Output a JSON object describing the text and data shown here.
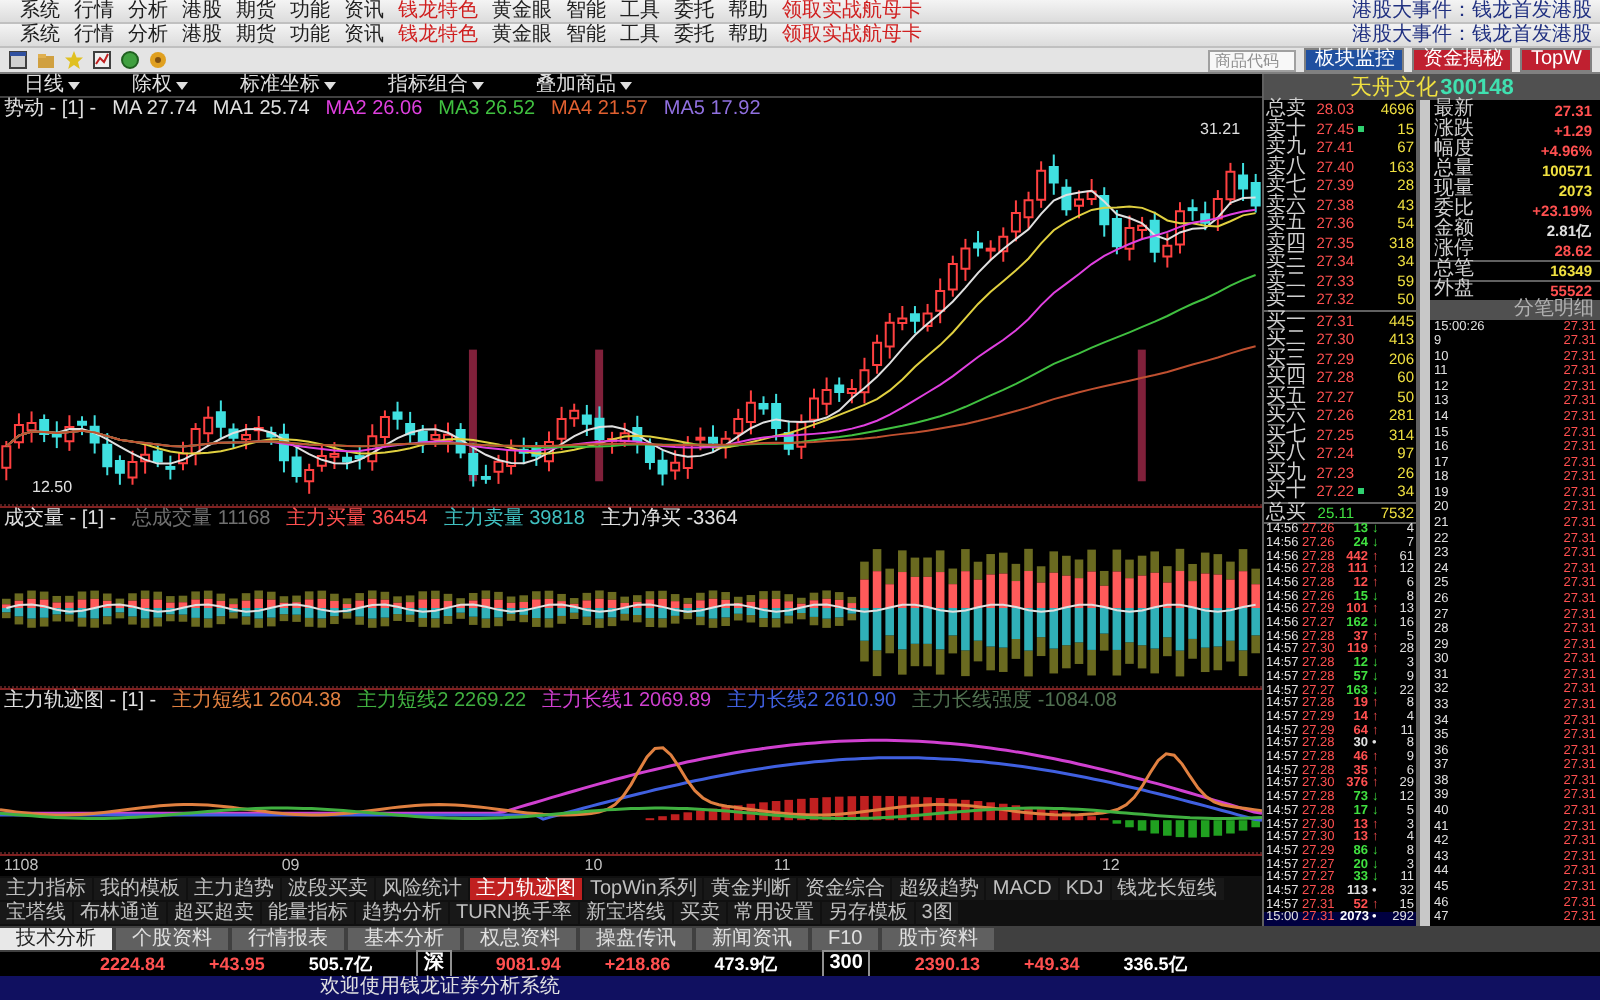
{
  "menu_bars": [
    {
      "items": [
        {
          "label": "系统",
          "highlight": false
        },
        {
          "label": "行情",
          "highlight": false
        },
        {
          "label": "分析",
          "highlight": false
        },
        {
          "label": "港股",
          "highlight": false
        },
        {
          "label": "期货",
          "highlight": false
        },
        {
          "label": "功能",
          "highlight": false
        },
        {
          "label": "资讯",
          "highlight": false
        },
        {
          "label": "钱龙特色",
          "highlight": true
        },
        {
          "label": "黄金眼",
          "highlight": false
        },
        {
          "label": "智能",
          "highlight": false
        },
        {
          "label": "工具",
          "highlight": false
        },
        {
          "label": "委托",
          "highlight": false
        },
        {
          "label": "帮助",
          "highlight": false
        },
        {
          "label": "领取实战航母卡",
          "highlight": true
        }
      ],
      "notice": "港股大事件：钱龙首发港股"
    },
    {
      "items": [
        {
          "label": "系统",
          "highlight": false
        },
        {
          "label": "行情",
          "highlight": false
        },
        {
          "label": "分析",
          "highlight": false
        },
        {
          "label": "港股",
          "highlight": false
        },
        {
          "label": "期货",
          "highlight": false
        },
        {
          "label": "功能",
          "highlight": false
        },
        {
          "label": "资讯",
          "highlight": false
        },
        {
          "label": "钱龙特色",
          "highlight": true
        },
        {
          "label": "黄金眼",
          "highlight": false
        },
        {
          "label": "智能",
          "highlight": false
        },
        {
          "label": "工具",
          "highlight": false
        },
        {
          "label": "委托",
          "highlight": false
        },
        {
          "label": "帮助",
          "highlight": false
        },
        {
          "label": "领取实战航母卡",
          "highlight": true
        }
      ],
      "notice": "港股大事件：钱龙首发港股"
    }
  ],
  "toolbar": {
    "search": {
      "placeholder": "商品代码"
    },
    "buttons": [
      {
        "label": "板块监控",
        "color": "#2050a0"
      },
      {
        "label": "资金揭秘",
        "color": "#c02030"
      },
      {
        "label": "TopW",
        "color": "#c02030"
      }
    ]
  },
  "chart_toolbar": {
    "dropdowns": [
      "日线",
      "除权",
      "标准坐标",
      "指标组合",
      "叠加商品"
    ]
  },
  "ma_row": {
    "title": "势动 - [1] -",
    "values": [
      {
        "label": "MA",
        "value": "27.74",
        "color": "#e0e0e0"
      },
      {
        "label": "MA1",
        "value": "25.74",
        "color": "#e0e0e0"
      },
      {
        "label": "MA2",
        "value": "26.06",
        "color": "#e040e0"
      },
      {
        "label": "MA3",
        "value": "26.52",
        "color": "#40c040"
      },
      {
        "label": "MA4",
        "value": "21.57",
        "color": "#e06030"
      },
      {
        "label": "MA5",
        "value": "17.92",
        "color": "#9070e0"
      }
    ]
  },
  "main_chart": {
    "high_label": "31.21",
    "low_label": "12.50"
  },
  "volume_panel": {
    "title": "成交量 - [1] -",
    "values": [
      {
        "label": "总成交量",
        "value": "11168",
        "color": "#707070"
      },
      {
        "label": "主力买量",
        "value": "36454",
        "color": "#ff5050"
      },
      {
        "label": "主力卖量",
        "value": "39818",
        "color": "#40c0c0"
      },
      {
        "label": "主力净买",
        "value": "-3364",
        "color": "#e0e0e0"
      }
    ]
  },
  "trajectory_panel": {
    "title": "主力轨迹图 - [1] -",
    "values": [
      {
        "label": "主力短线1",
        "value": "2604.38",
        "color": "#e08040"
      },
      {
        "label": "主力短线2",
        "value": "2269.22",
        "color": "#40b040"
      },
      {
        "label": "主力长线1",
        "value": "2069.89",
        "color": "#d040d0"
      },
      {
        "label": "主力长线2",
        "value": "2610.90",
        "color": "#4060e0"
      },
      {
        "label": "主力长线强度",
        "value": "-1084.08",
        "color": "#507050"
      }
    ]
  },
  "x_axis": [
    "1108",
    "09",
    "10",
    "11",
    "12"
  ],
  "indicator_tabs": [
    {
      "label": "主力指标",
      "selected": false
    },
    {
      "label": "我的模板",
      "selected": false
    },
    {
      "label": "主力趋势",
      "selected": false
    },
    {
      "label": "波段买卖",
      "selected": false
    },
    {
      "label": "风险统计",
      "selected": false
    },
    {
      "label": "主力轨迹图",
      "selected": true
    },
    {
      "label": "TopWin系列",
      "selected": false
    },
    {
      "label": "黄金判断",
      "selected": false
    },
    {
      "label": "资金综合",
      "selected": false
    },
    {
      "label": "超级趋势",
      "selected": false
    },
    {
      "label": "MACD",
      "selected": false
    },
    {
      "label": "KDJ",
      "selected": false
    },
    {
      "label": "钱龙长短线",
      "selected": false
    },
    {
      "label": "宝塔线",
      "selected": false
    },
    {
      "label": "布林通道",
      "selected": false
    },
    {
      "label": "超买超卖",
      "selected": false
    },
    {
      "label": "能量指标",
      "selected": false
    },
    {
      "label": "趋势分析",
      "selected": false
    },
    {
      "label": "TURN换手率",
      "selected": false
    },
    {
      "label": "新宝塔线",
      "selected": false
    },
    {
      "label": "买卖",
      "selected": false
    },
    {
      "label": "常用设置",
      "selected": false
    },
    {
      "label": "另存模板",
      "selected": false
    },
    {
      "label": "3图",
      "selected": false
    }
  ],
  "bottom_tabs": [
    {
      "label": "技术分析",
      "selected": true
    },
    {
      "label": "个股资料",
      "selected": false
    },
    {
      "label": "行情报表",
      "selected": false
    },
    {
      "label": "基本分析",
      "selected": false
    },
    {
      "label": "权息资料",
      "selected": false
    },
    {
      "label": "操盘传讯",
      "selected": false
    },
    {
      "label": "新闻资讯",
      "selected": false
    },
    {
      "label": "F10",
      "selected": false
    },
    {
      "label": "股市资料",
      "selected": false
    }
  ],
  "status_bar": [
    {
      "text": "2224.84",
      "color": "#ff5050",
      "boxed": false
    },
    {
      "text": "+43.95",
      "color": "#ff5050",
      "boxed": false
    },
    {
      "text": "505.7亿",
      "color": "#ffffff",
      "boxed": false
    },
    {
      "text": "深",
      "boxed": true
    },
    {
      "text": "9081.94",
      "color": "#ff5050",
      "boxed": false
    },
    {
      "text": "+218.86",
      "color": "#ff5050",
      "boxed": false
    },
    {
      "text": "473.9亿",
      "color": "#ffffff",
      "boxed": false
    },
    {
      "text": "300",
      "boxed": true
    },
    {
      "text": "2390.13",
      "color": "#ff5050",
      "boxed": false
    },
    {
      "text": "+49.34",
      "color": "#ff5050",
      "boxed": false
    },
    {
      "text": "336.5亿",
      "color": "#ffffff",
      "boxed": false
    }
  ],
  "ticker": "欢迎使用钱龙证券分析系统",
  "quote": {
    "name": "天舟文化",
    "code": "300148",
    "total_sell": {
      "label": "总卖",
      "price": "28.03",
      "volume": "4696"
    },
    "asks": [
      {
        "label": "卖十",
        "price": "27.45",
        "volume": "15",
        "flag": true
      },
      {
        "label": "卖九",
        "price": "27.41",
        "volume": "67",
        "flag": false
      },
      {
        "label": "卖八",
        "price": "27.40",
        "volume": "163",
        "flag": false
      },
      {
        "label": "卖七",
        "price": "27.39",
        "volume": "28",
        "flag": false
      },
      {
        "label": "卖六",
        "price": "27.38",
        "volume": "43",
        "flag": false
      },
      {
        "label": "卖五",
        "price": "27.36",
        "volume": "54",
        "flag": false
      },
      {
        "label": "卖四",
        "price": "27.35",
        "volume": "318",
        "flag": false
      },
      {
        "label": "卖三",
        "price": "27.34",
        "volume": "34",
        "flag": false
      },
      {
        "label": "卖二",
        "price": "27.33",
        "volume": "59",
        "flag": false
      },
      {
        "label": "卖一",
        "price": "27.32",
        "volume": "50",
        "flag": false
      }
    ],
    "bids": [
      {
        "label": "买一",
        "price": "27.31",
        "volume": "445",
        "flag": false
      },
      {
        "label": "买二",
        "price": "27.30",
        "volume": "413",
        "flag": false
      },
      {
        "label": "买三",
        "price": "27.29",
        "volume": "206",
        "flag": false
      },
      {
        "label": "买四",
        "price": "27.28",
        "volume": "60",
        "flag": false
      },
      {
        "label": "买五",
        "price": "27.27",
        "volume": "50",
        "flag": false
      },
      {
        "label": "买六",
        "price": "27.26",
        "volume": "281",
        "flag": false
      },
      {
        "label": "买七",
        "price": "27.25",
        "volume": "314",
        "flag": false
      },
      {
        "label": "买八",
        "price": "27.24",
        "volume": "97",
        "flag": false
      },
      {
        "label": "买九",
        "price": "27.23",
        "volume": "26",
        "flag": false
      },
      {
        "label": "买十",
        "price": "27.22",
        "volume": "34",
        "flag": true
      }
    ],
    "total_buy": {
      "label": "总买",
      "price": "25.11",
      "volume": "7532"
    },
    "stats": [
      {
        "label": "最新",
        "value": "27.31",
        "color": "#ff5050"
      },
      {
        "label": "涨跌",
        "value": "+1.29",
        "color": "#ff5050"
      },
      {
        "label": "幅度",
        "value": "+4.96%",
        "color": "#ff5050"
      },
      {
        "label": "总量",
        "value": "100571",
        "color": "#f0e040"
      },
      {
        "label": "现量",
        "value": "2073",
        "color": "#f0e040"
      },
      {
        "label": "委比",
        "value": "+23.19%",
        "color": "#ff5050"
      },
      {
        "label": "金额",
        "value": "2.81亿",
        "color": "#e0e0e0"
      },
      {
        "label": "涨停",
        "value": "28.62",
        "color": "#ff5050"
      }
    ],
    "summary": [
      {
        "label": "总笔",
        "value": "16349",
        "color": "#f0e040"
      },
      {
        "label": "外盘",
        "value": "55522",
        "color": "#ff5050"
      }
    ],
    "trades": [
      {
        "time": "14:56",
        "price": "27.26",
        "volume": "13",
        "arrow": "↓",
        "color": "#40e040",
        "count": "4"
      },
      {
        "time": "14:56",
        "price": "27.26",
        "volume": "24",
        "arrow": "↓",
        "color": "#40e040",
        "count": "7"
      },
      {
        "time": "14:56",
        "price": "27.28",
        "volume": "442",
        "arrow": "↑",
        "color": "#ff5050",
        "count": "61"
      },
      {
        "time": "14:56",
        "price": "27.28",
        "volume": "111",
        "arrow": "↑",
        "color": "#ff5050",
        "count": "12"
      },
      {
        "time": "14:56",
        "price": "27.28",
        "volume": "12",
        "arrow": "↑",
        "color": "#ff5050",
        "count": "6"
      },
      {
        "time": "14:56",
        "price": "27.26",
        "volume": "15",
        "arrow": "↓",
        "color": "#40e040",
        "count": "8"
      },
      {
        "time": "14:56",
        "price": "27.29",
        "volume": "101",
        "arrow": "↑",
        "color": "#ff5050",
        "count": "13"
      },
      {
        "time": "14:56",
        "price": "27.27",
        "volume": "162",
        "arrow": "↓",
        "color": "#40e040",
        "count": "16"
      },
      {
        "time": "14:56",
        "price": "27.28",
        "volume": "37",
        "arrow": "↑",
        "color": "#ff5050",
        "count": "5"
      },
      {
        "time": "14:57",
        "price": "27.30",
        "volume": "119",
        "arrow": "↑",
        "color": "#ff5050",
        "count": "28"
      },
      {
        "time": "14:57",
        "price": "27.28",
        "volume": "12",
        "arrow": "↓",
        "color": "#40e040",
        "count": "3"
      },
      {
        "time": "14:57",
        "price": "27.28",
        "volume": "57",
        "arrow": "↓",
        "color": "#40e040",
        "count": "9"
      },
      {
        "time": "14:57",
        "price": "27.27",
        "volume": "163",
        "arrow": "↓",
        "color": "#40e040",
        "count": "22"
      },
      {
        "time": "14:57",
        "price": "27.28",
        "volume": "19",
        "arrow": "↑",
        "color": "#ff5050",
        "count": "8"
      },
      {
        "time": "14:57",
        "price": "27.29",
        "volume": "14",
        "arrow": "↑",
        "color": "#ff5050",
        "count": "4"
      },
      {
        "time": "14:57",
        "price": "27.29",
        "volume": "64",
        "arrow": "↑",
        "color": "#ff5050",
        "count": "11"
      },
      {
        "time": "14:57",
        "price": "27.28",
        "volume": "30",
        "arrow": "•",
        "color": "#e0e0e0",
        "count": "8"
      },
      {
        "time": "14:57",
        "price": "27.28",
        "volume": "46",
        "arrow": "↑",
        "color": "#ff5050",
        "count": "9"
      },
      {
        "time": "14:57",
        "price": "27.28",
        "volume": "35",
        "arrow": "↑",
        "color": "#ff5050",
        "count": "6"
      },
      {
        "time": "14:57",
        "price": "27.30",
        "volume": "376",
        "arrow": "↑",
        "color": "#ff5050",
        "count": "29"
      },
      {
        "time": "14:57",
        "price": "27.28",
        "volume": "73",
        "arrow": "↓",
        "color": "#40e040",
        "count": "12"
      },
      {
        "time": "14:57",
        "price": "27.28",
        "volume": "17",
        "arrow": "↓",
        "color": "#40e040",
        "count": "5"
      },
      {
        "time": "14:57",
        "price": "27.30",
        "volume": "13",
        "arrow": "↑",
        "color": "#ff5050",
        "count": "3"
      },
      {
        "time": "14:57",
        "price": "27.30",
        "volume": "13",
        "arrow": "↑",
        "color": "#ff5050",
        "count": "4"
      },
      {
        "time": "14:57",
        "price": "27.29",
        "volume": "86",
        "arrow": "↓",
        "color": "#40e040",
        "count": "8"
      },
      {
        "time": "14:57",
        "price": "27.27",
        "volume": "20",
        "arrow": "↓",
        "color": "#40e040",
        "count": "3"
      },
      {
        "time": "14:57",
        "price": "27.27",
        "volume": "33",
        "arrow": "↓",
        "color": "#40e040",
        "count": "11"
      },
      {
        "time": "14:57",
        "price": "27.28",
        "volume": "113",
        "arrow": "•",
        "color": "#e0e0e0",
        "count": "32"
      },
      {
        "time": "14:57",
        "price": "27.31",
        "volume": "52",
        "arrow": "↑",
        "color": "#ff5050",
        "count": "15"
      },
      {
        "time": "15:00",
        "price": "27.31",
        "volume": "2073",
        "arrow": "•",
        "color": "#ffffff",
        "count": "292"
      }
    ],
    "ticks_header": "分笔明细",
    "ticks": [
      {
        "time": "15:00:26",
        "price": "27.31"
      },
      {
        "time": "9",
        "price": "27.31"
      },
      {
        "time": "10",
        "price": "27.31"
      },
      {
        "time": "11",
        "price": "27.31"
      },
      {
        "time": "12",
        "price": "27.31"
      },
      {
        "time": "13",
        "price": "27.31"
      },
      {
        "time": "14",
        "price": "27.31"
      },
      {
        "time": "15",
        "price": "27.31"
      },
      {
        "time": "16",
        "price": "27.31"
      },
      {
        "time": "17",
        "price": "27.31"
      },
      {
        "time": "18",
        "price": "27.31"
      },
      {
        "time": "19",
        "price": "27.31"
      },
      {
        "time": "20",
        "price": "27.31"
      },
      {
        "time": "21",
        "price": "27.31"
      },
      {
        "time": "22",
        "price": "27.31"
      },
      {
        "time": "23",
        "price": "27.31"
      },
      {
        "time": "24",
        "price": "27.31"
      },
      {
        "time": "25",
        "price": "27.31"
      },
      {
        "time": "26",
        "price": "27.31"
      },
      {
        "time": "27",
        "price": "27.31"
      },
      {
        "time": "28",
        "price": "27.31"
      },
      {
        "time": "29",
        "price": "27.31"
      },
      {
        "time": "30",
        "price": "27.31"
      },
      {
        "time": "31",
        "price": "27.31"
      },
      {
        "time": "32",
        "price": "27.31"
      },
      {
        "time": "33",
        "price": "27.31"
      },
      {
        "time": "34",
        "price": "27.31"
      },
      {
        "time": "35",
        "price": "27.31"
      },
      {
        "time": "36",
        "price": "27.31"
      },
      {
        "time": "37",
        "price": "27.31"
      },
      {
        "time": "38",
        "price": "27.31"
      },
      {
        "time": "39",
        "price": "27.31"
      },
      {
        "time": "40",
        "price": "27.31"
      },
      {
        "time": "41",
        "price": "27.31"
      },
      {
        "time": "42",
        "price": "27.31"
      },
      {
        "time": "43",
        "price": "27.31"
      },
      {
        "time": "44",
        "price": "27.31"
      },
      {
        "time": "45",
        "price": "27.31"
      },
      {
        "time": "46",
        "price": "27.31"
      },
      {
        "time": "47",
        "price": "27.31"
      }
    ]
  }
}
